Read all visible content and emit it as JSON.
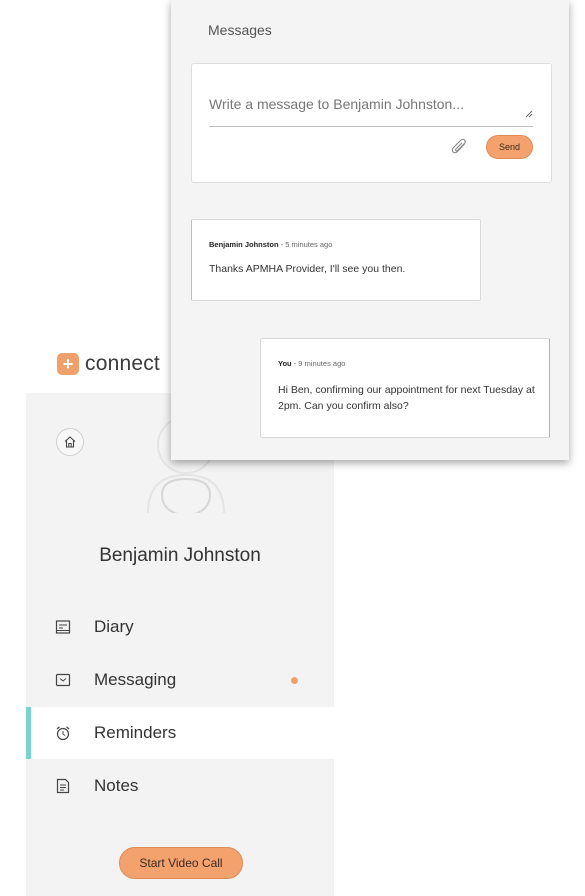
{
  "brand": {
    "name": "connect",
    "mark": "+"
  },
  "colors": {
    "accent": "#f0a06a",
    "active": "#7ad3d3",
    "panel": "#f3f3f3"
  },
  "sidebar": {
    "patient_name": "Benjamin Johnston",
    "items": [
      {
        "label": "Diary",
        "icon": "diary-icon",
        "active": false
      },
      {
        "label": "Messaging",
        "icon": "message-icon",
        "active": false,
        "unread": true
      },
      {
        "label": "Reminders",
        "icon": "alarm-clock-icon",
        "active": true
      },
      {
        "label": "Notes",
        "icon": "notes-icon",
        "active": false
      }
    ],
    "video_call_label": "Start Video Call"
  },
  "messages": {
    "title": "Messages",
    "compose_placeholder": "Write a message to Benjamin Johnston...",
    "send_label": "Send",
    "thread": [
      {
        "author": "Benjamin Johnston",
        "time": "5 minutes ago",
        "body": "Thanks APMHA Provider, I'll see you then.",
        "direction": "received"
      },
      {
        "author": "You",
        "time": "9 minutes ago",
        "body": "Hi Ben, confirming our appointment for next Tuesday at 2pm. Can you confirm also?",
        "direction": "sent"
      }
    ]
  }
}
